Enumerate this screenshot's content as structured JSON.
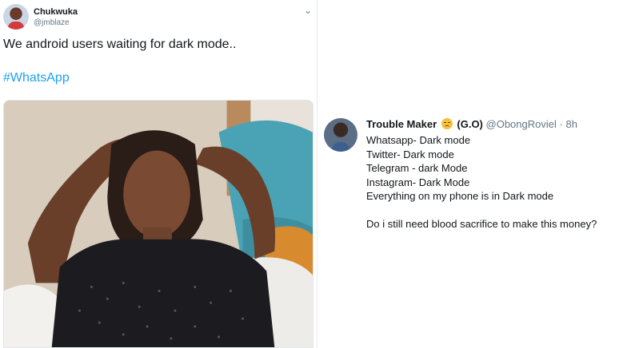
{
  "left_tweet": {
    "name": "Chukwuka",
    "handle": "@jmblaze",
    "text": "We android users waiting for dark mode..",
    "hashtag": "#WhatsApp"
  },
  "right_tweet": {
    "name": "Trouble Maker",
    "emoji": "relieved-face-emoji",
    "tag": "(G.O)",
    "handle": "@ObongRoviel",
    "separator": "·",
    "time": "8h",
    "lines": [
      "Whatsapp- Dark mode",
      "Twitter- Dark mode",
      "Telegram - dark Mode",
      "Instagram- Dark Mode",
      "Everything on my phone is in Dark mode"
    ],
    "question": "Do i still need blood sacrifice to make this money?"
  },
  "colors": {
    "link": "#1da1f2",
    "muted": "#657786",
    "text": "#14171a"
  }
}
